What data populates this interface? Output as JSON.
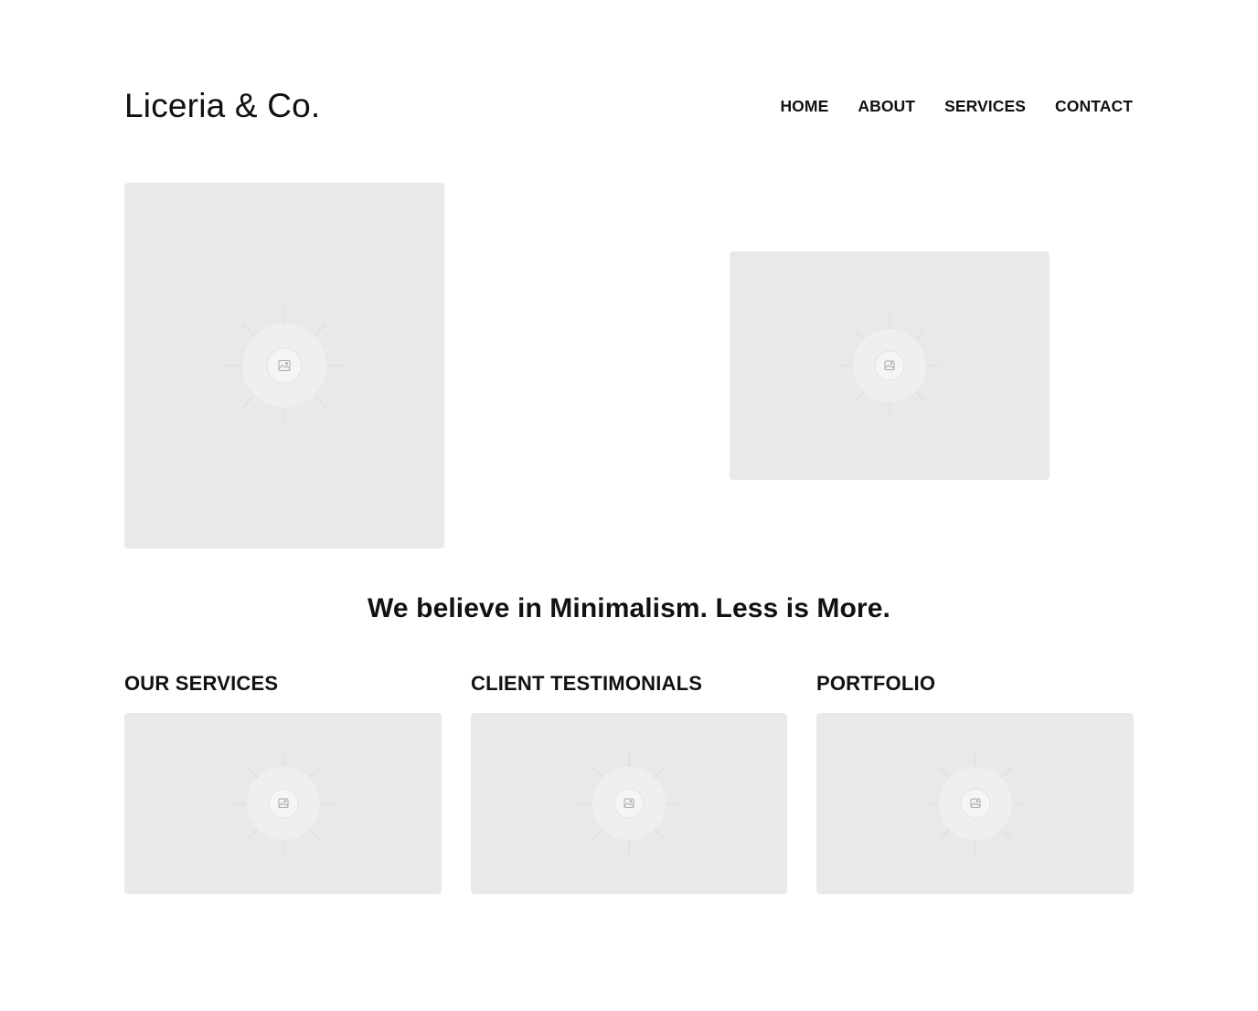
{
  "brand": {
    "name": "Liceria & Co."
  },
  "nav": {
    "items": [
      {
        "label": "HOME"
      },
      {
        "label": "ABOUT"
      },
      {
        "label": "SERVICES"
      },
      {
        "label": "CONTACT"
      }
    ]
  },
  "hero": {
    "images": [
      {
        "icon": "image-placeholder-icon"
      },
      {
        "icon": "image-placeholder-icon"
      }
    ]
  },
  "tagline": "We believe in Minimalism. Less is More.",
  "sections": [
    {
      "title": "OUR SERVICES",
      "icon": "image-placeholder-icon"
    },
    {
      "title": "CLIENT TESTIMONIALS",
      "icon": "image-placeholder-icon"
    },
    {
      "title": "PORTFOLIO",
      "icon": "image-placeholder-icon"
    }
  ],
  "colors": {
    "background": "#ffffff",
    "text": "#111111",
    "placeholder": "#e9e9e9"
  }
}
